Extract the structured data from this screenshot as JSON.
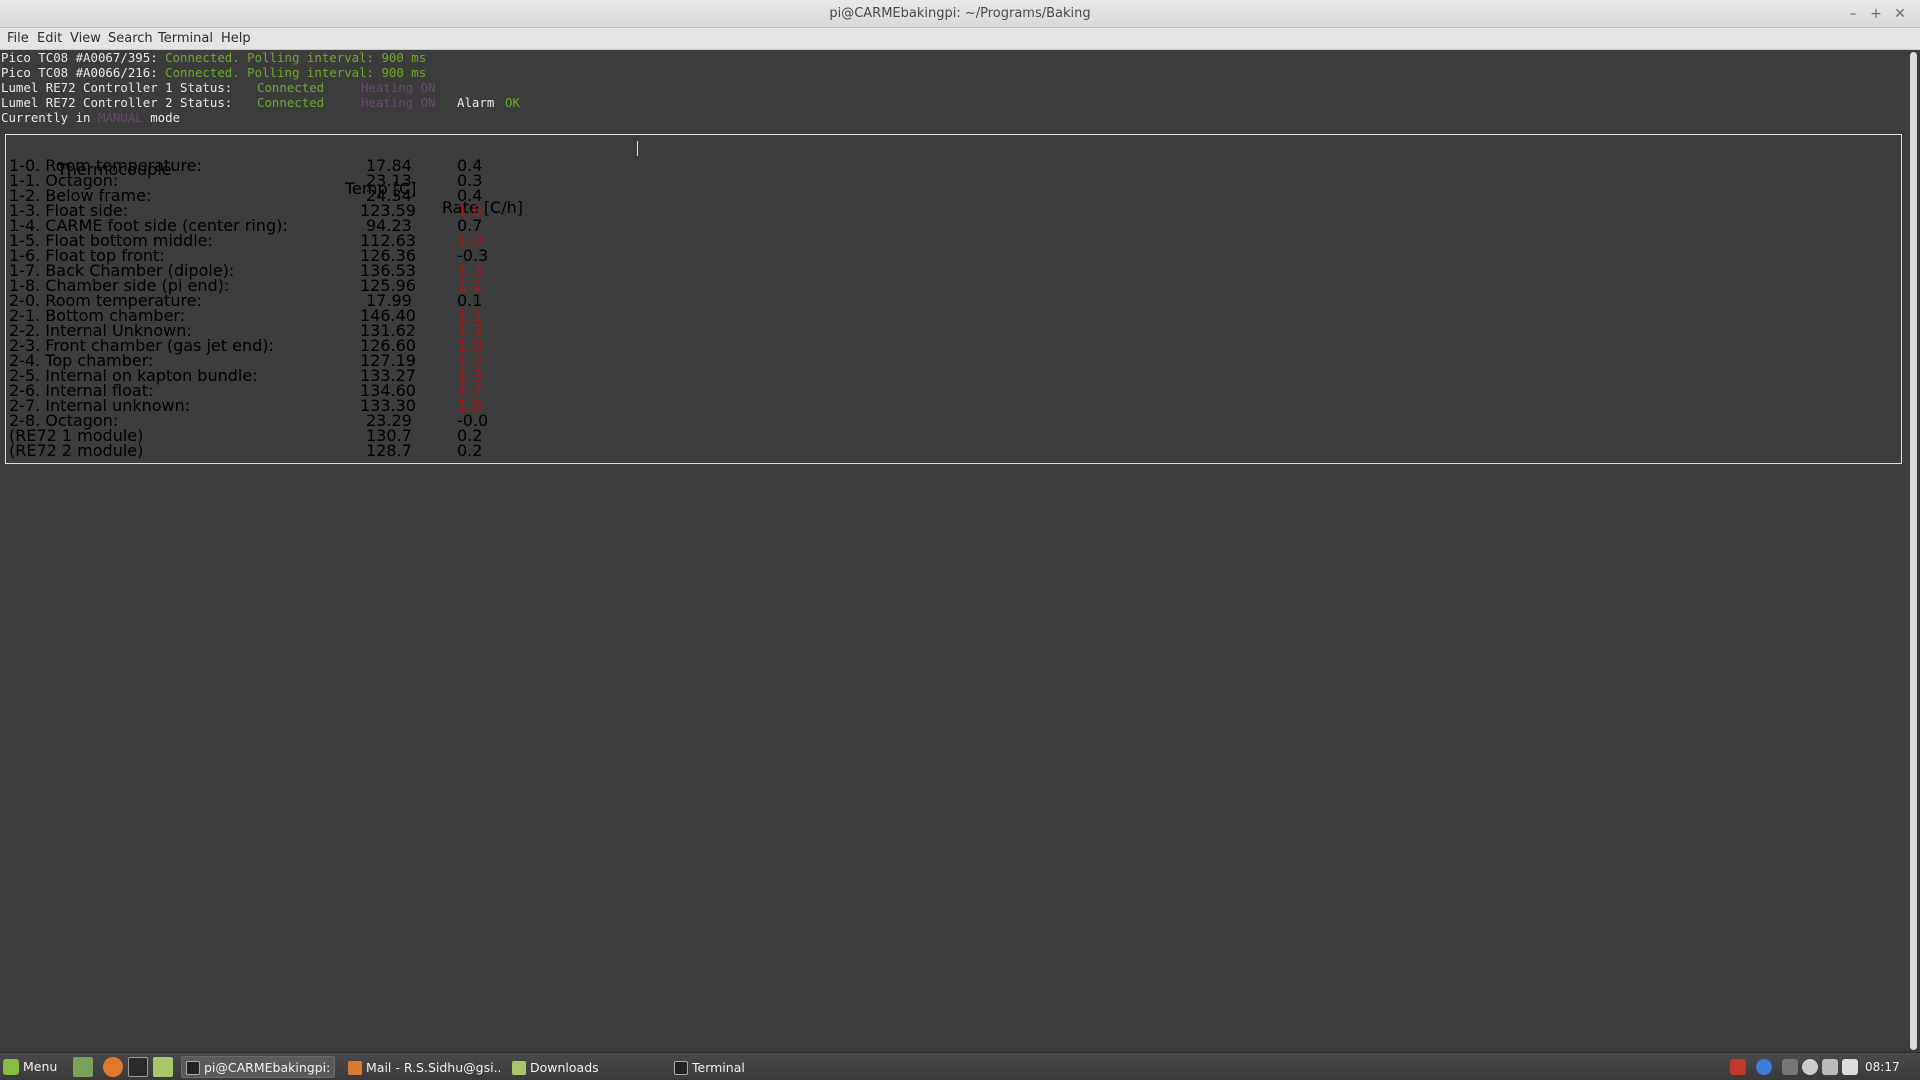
{
  "window": {
    "title": "pi@CARMEbakingpi: ~/Programs/Baking",
    "controls": [
      "–",
      "+",
      "✕"
    ]
  },
  "menubar": [
    "File",
    "Edit",
    "View",
    "Search",
    "Terminal",
    "Help"
  ],
  "status": [
    {
      "label": "Pico TC08 #A0067/395: ",
      "value": "Connected. Polling interval: 900 ms"
    },
    {
      "label": "Pico TC08 #A0066/216: ",
      "value": "Connected. Polling interval: 900 ms"
    },
    {
      "label": "Lumel RE72 Controller 1 Status: ",
      "value": "Connected",
      "heating": "Heating ON"
    },
    {
      "label": "Lumel RE72 Controller 2 Status: ",
      "value": "Connected",
      "heating": "Heating ON",
      "alarm_label": "Alarm",
      "alarm_value": "OK"
    }
  ],
  "mode": {
    "prefix": "Currently in ",
    "value": "MANUAL",
    "suffix": " mode"
  },
  "table": {
    "headers": {
      "name": "Thermocouple",
      "temp": "Temp [C]",
      "rate": "Rate [C/h]"
    },
    "rows": [
      {
        "name": "1-0. Room temperature:",
        "temp": "17.84",
        "rate": "0.4",
        "alert": false
      },
      {
        "name": "1-1. Octagon:",
        "temp": "23.13",
        "rate": "0.3",
        "alert": false
      },
      {
        "name": "1-2. Below frame:",
        "temp": "24.34",
        "rate": "0.4",
        "alert": false
      },
      {
        "name": "1-3. Float side:",
        "temp": "123.59",
        "rate": "1.0",
        "alert": true
      },
      {
        "name": "1-4. CARME foot side (center ring):",
        "temp": "94.23",
        "rate": "0.7",
        "alert": false
      },
      {
        "name": "1-5. Float bottom middle:",
        "temp": "112.63",
        "rate": "1.0",
        "alert": true
      },
      {
        "name": "1-6. Float top front:",
        "temp": "126.36",
        "rate": "-0.3",
        "alert": false
      },
      {
        "name": "1-7. Back Chamber (dipole):",
        "temp": "136.53",
        "rate": "1.3",
        "alert": true
      },
      {
        "name": "1-8. Chamber side (pi end):",
        "temp": "125.96",
        "rate": "1.1",
        "alert": true
      },
      {
        "name": "2-0. Room temperature:",
        "temp": "17.99",
        "rate": "0.1",
        "alert": false
      },
      {
        "name": "2-1. Bottom chamber:",
        "temp": "146.40",
        "rate": "1.1",
        "alert": true
      },
      {
        "name": "2-2. Internal Unknown:",
        "temp": "131.62",
        "rate": "1.3",
        "alert": true
      },
      {
        "name": "2-3. Front chamber (gas jet end):",
        "temp": "126.60",
        "rate": "1.0",
        "alert": true
      },
      {
        "name": "2-4. Top chamber:",
        "temp": "127.19",
        "rate": "1.3",
        "alert": true
      },
      {
        "name": "2-5. Internal on kapton bundle:",
        "temp": "133.27",
        "rate": "1.3",
        "alert": true
      },
      {
        "name": "2-6. Internal float:",
        "temp": "134.60",
        "rate": "1.7",
        "alert": true
      },
      {
        "name": "2-7. Internal unknown:",
        "temp": "133.30",
        "rate": "1.6",
        "alert": true
      },
      {
        "name": "2-8. Octagon:",
        "temp": "23.29",
        "rate": "-0.0",
        "alert": false
      },
      {
        "name": "(RE72 1 module)",
        "temp": "130.7",
        "rate": "0.2",
        "alert": false
      },
      {
        "name": "(RE72 2 module)",
        "temp": "128.7",
        "rate": "0.2",
        "alert": false
      }
    ]
  },
  "colors": {
    "ok": "#6aaa2a",
    "heating": "#6a4a72",
    "alert": "#a01818"
  },
  "taskbar": {
    "menu_label": "Menu",
    "tasks": [
      {
        "label": "pi@CARMEbakingpi: ...",
        "icon": "terminal-icon"
      },
      {
        "label": "Mail - R.S.Sidhu@gsi....",
        "icon": "thunderbird-icon"
      },
      {
        "label": "Downloads",
        "icon": "folder-icon"
      },
      {
        "label": "Terminal",
        "icon": "terminal-icon"
      }
    ],
    "tray_icons": [
      "shield-icon",
      "bluetooth-icon",
      "network-icon",
      "user-icon",
      "pen-icon",
      "battery-icon"
    ],
    "clock": "08:17"
  }
}
